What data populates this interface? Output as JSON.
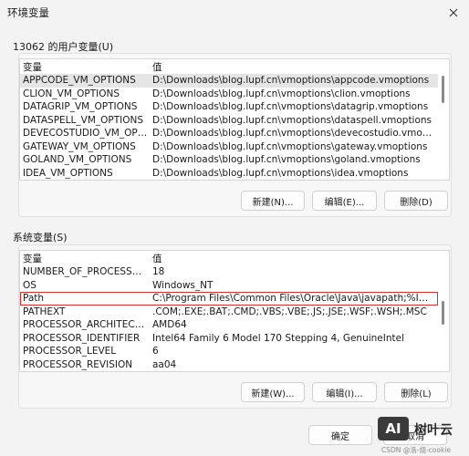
{
  "window": {
    "title": "环境变量"
  },
  "user_vars": {
    "label": "13062 的用户变量(U)",
    "columns": [
      "变量",
      "值"
    ],
    "rows": [
      {
        "name": "APPCODE_VM_OPTIONS",
        "value": "D:\\Downloads\\blog.lupf.cn\\vmoptions\\appcode.vmoptions"
      },
      {
        "name": "CLION_VM_OPTIONS",
        "value": "D:\\Downloads\\blog.lupf.cn\\vmoptions\\clion.vmoptions"
      },
      {
        "name": "DATAGRIP_VM_OPTIONS",
        "value": "D:\\Downloads\\blog.lupf.cn\\vmoptions\\datagrip.vmoptions"
      },
      {
        "name": "DATASPELL_VM_OPTIONS",
        "value": "D:\\Downloads\\blog.lupf.cn\\vmoptions\\dataspell.vmoptions"
      },
      {
        "name": "DEVECOSTUDIO_VM_OPTI...",
        "value": "D:\\Downloads\\blog.lupf.cn\\vmoptions\\devecostudio.vmoptions"
      },
      {
        "name": "GATEWAY_VM_OPTIONS",
        "value": "D:\\Downloads\\blog.lupf.cn\\vmoptions\\gateway.vmoptions"
      },
      {
        "name": "GOLAND_VM_OPTIONS",
        "value": "D:\\Downloads\\blog.lupf.cn\\vmoptions\\goland.vmoptions"
      },
      {
        "name": "IDEA_VM_OPTIONS",
        "value": "D:\\Downloads\\blog.lupf.cn\\vmoptions\\idea.vmoptions"
      }
    ],
    "buttons": {
      "new": "新建(N)...",
      "edit": "编辑(E)...",
      "delete": "删除(D)"
    }
  },
  "system_vars": {
    "label": "系统变量(S)",
    "columns": [
      "变量",
      "值"
    ],
    "rows": [
      {
        "name": "NUMBER_OF_PROCESSORS",
        "value": "18"
      },
      {
        "name": "OS",
        "value": "Windows_NT"
      },
      {
        "name": "Path",
        "value": "C:\\Program Files\\Common Files\\Oracle\\Java\\javapath;%INTEL_..."
      },
      {
        "name": "PATHEXT",
        "value": ".COM;.EXE;.BAT;.CMD;.VBS;.VBE;.JS;.JSE;.WSF;.WSH;.MSC"
      },
      {
        "name": "PROCESSOR_ARCHITECTU...",
        "value": "AMD64"
      },
      {
        "name": "PROCESSOR_IDENTIFIER",
        "value": "Intel64 Family 6 Model 170 Stepping 4, GenuineIntel"
      },
      {
        "name": "PROCESSOR_LEVEL",
        "value": "6"
      },
      {
        "name": "PROCESSOR_REVISION",
        "value": "aa04"
      }
    ],
    "buttons": {
      "new": "新建(W)...",
      "edit": "编辑(I)...",
      "delete": "删除(L)"
    }
  },
  "footer": {
    "ok": "确定",
    "cancel": "取消"
  },
  "watermark": {
    "badge": "AI",
    "brand": "树叶云",
    "credit": "CSDN @洛-烧-cookie"
  },
  "colors": {
    "highlight_border": "#d9302c",
    "selected_row": "#e5e5e5"
  }
}
